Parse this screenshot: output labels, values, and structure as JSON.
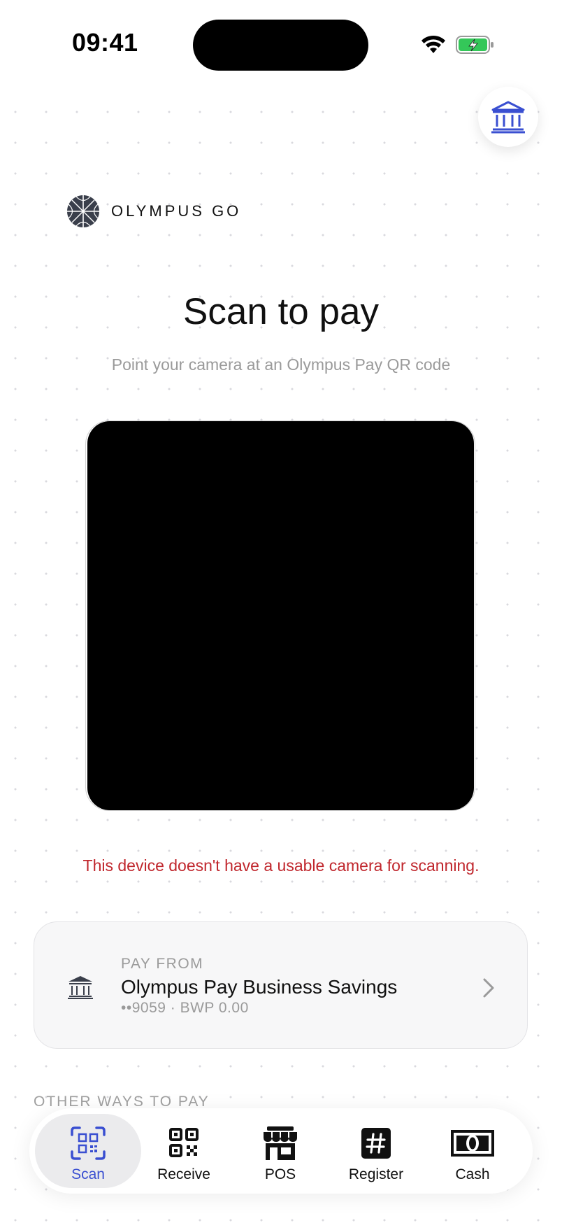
{
  "status_bar": {
    "time": "09:41"
  },
  "brand": {
    "name": "OLYMPUS GO"
  },
  "header": {
    "title": "Scan to pay",
    "subtitle": "Point your camera at an Olympus Pay QR code"
  },
  "scanner": {
    "error": "This device doesn't have a usable camera for scanning."
  },
  "pay_from": {
    "label": "PAY FROM",
    "account_name": "Olympus Pay Business Savings",
    "account_detail": "••9059 · BWP 0.00"
  },
  "other_ways": {
    "label": "OTHER WAYS TO PAY"
  },
  "tabs": [
    {
      "label": "Scan",
      "icon": "qr-scan-icon",
      "active": true
    },
    {
      "label": "Receive",
      "icon": "qr-code-icon",
      "active": false
    },
    {
      "label": "POS",
      "icon": "storefront-icon",
      "active": false
    },
    {
      "label": "Register",
      "icon": "hash-icon",
      "active": false
    },
    {
      "label": "Cash",
      "icon": "banknote-icon",
      "active": false
    }
  ],
  "colors": {
    "accent": "#3a4fd1",
    "error": "#c0272d",
    "battery": "#34c759"
  }
}
